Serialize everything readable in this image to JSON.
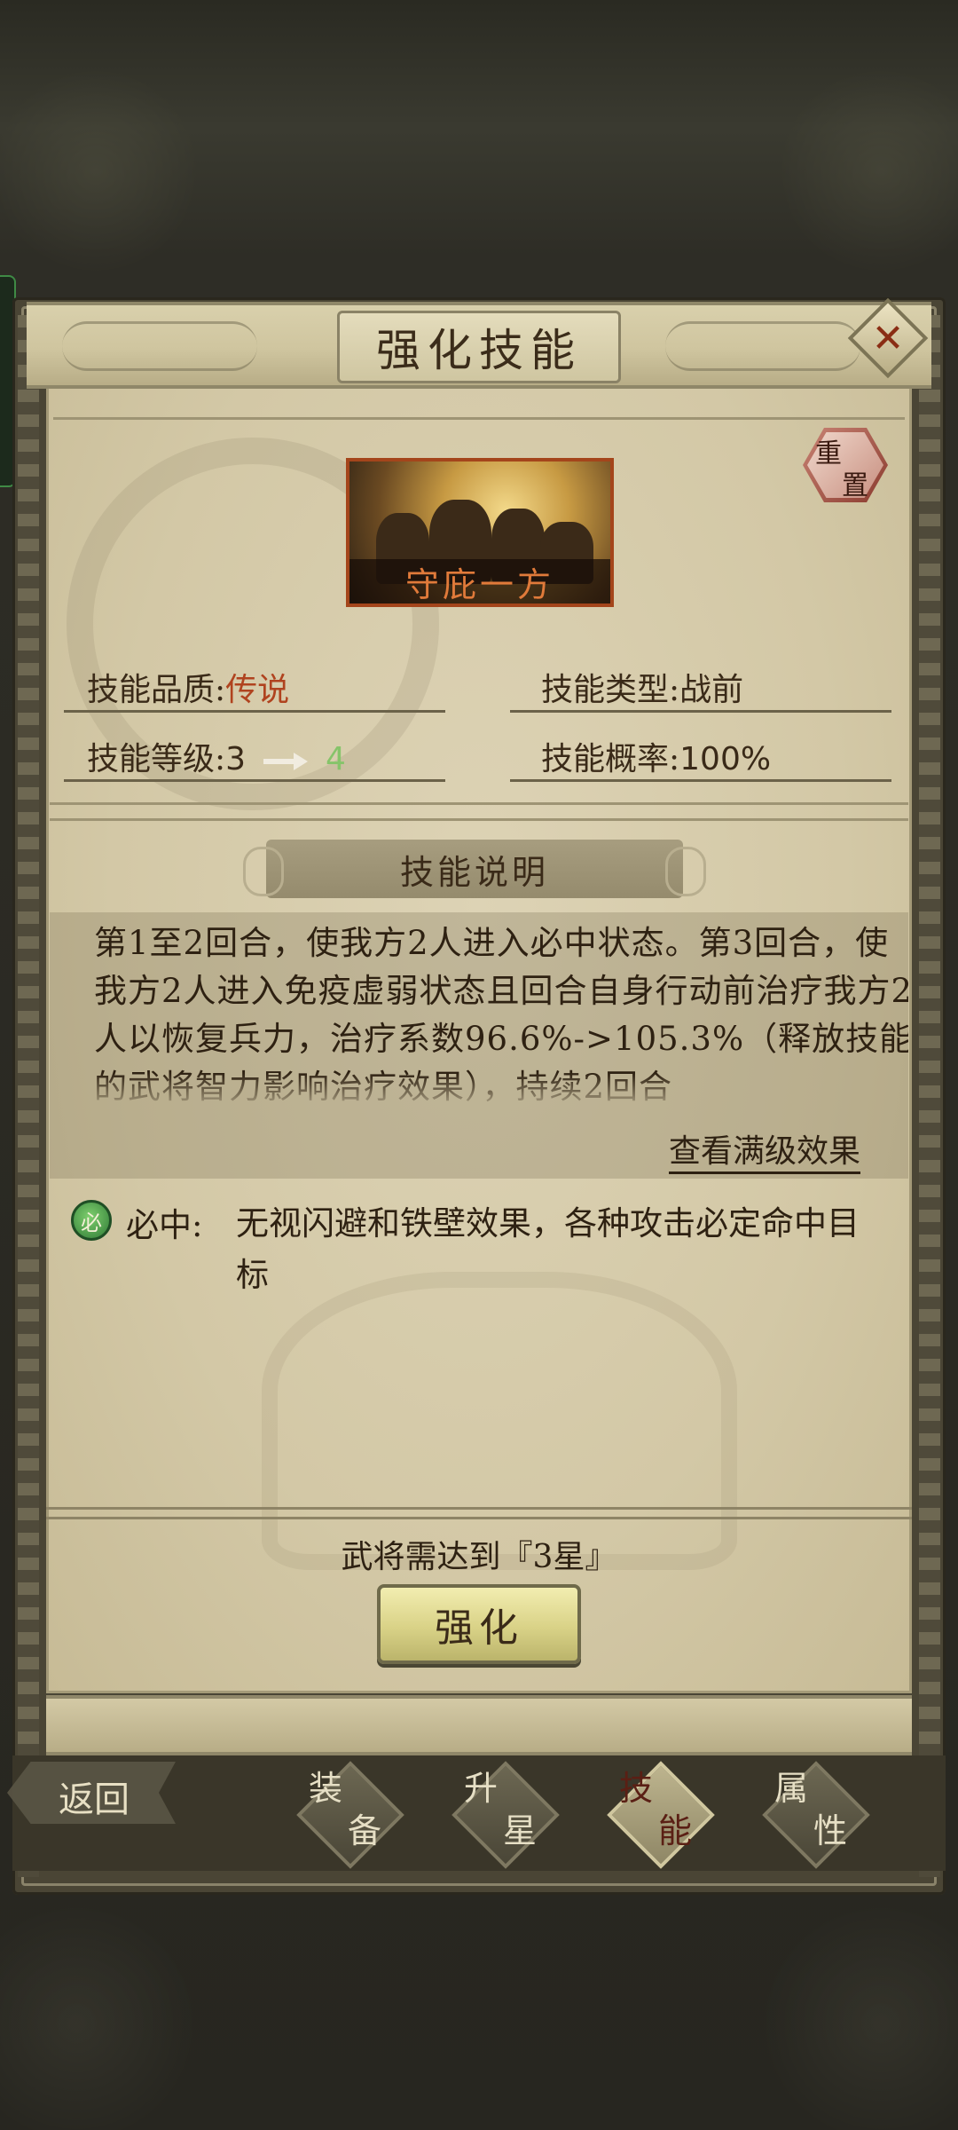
{
  "dialog": {
    "title": "强化技能",
    "close_label": "✕",
    "reset_label": [
      "重",
      "置"
    ]
  },
  "skill": {
    "name": "守庇一方",
    "quality_label": "技能品质:",
    "quality_value": "传说",
    "type_label": "技能类型:",
    "type_value": "战前",
    "level_label": "技能等级:",
    "level_current": "3",
    "level_next": "4",
    "rate_label": "技能概率:",
    "rate_value": "100%"
  },
  "description": {
    "section_title": "技能说明",
    "text": "第1至2回合，使我方2人进入必中状态。第3回合，使我方2人进入免疫虚弱状态且回合自身行动前治疗我方2人以恢复兵力，治疗系数96.6%->105.3%（释放技能的武将智力影响治疗效果），持续2回合",
    "full_effect_link": "查看满级效果"
  },
  "keyword": {
    "icon_char": "必",
    "label": "必中:",
    "text": "无视闪避和铁壁效果，各种攻击必定命中目标"
  },
  "requirement": {
    "text": "武将需达到『3星』"
  },
  "action": {
    "strengthen_label": "强化"
  },
  "nav": {
    "back_label": "返回",
    "tabs": [
      {
        "c1": "装",
        "c2": "备",
        "active": false
      },
      {
        "c1": "升",
        "c2": "星",
        "active": false
      },
      {
        "c1": "技",
        "c2": "能",
        "active": true
      },
      {
        "c1": "属",
        "c2": "性",
        "active": false
      }
    ]
  },
  "colors": {
    "quality_legendary": "#b0431f",
    "level_next": "#86c46a",
    "skill_name": "#e07a3a"
  }
}
